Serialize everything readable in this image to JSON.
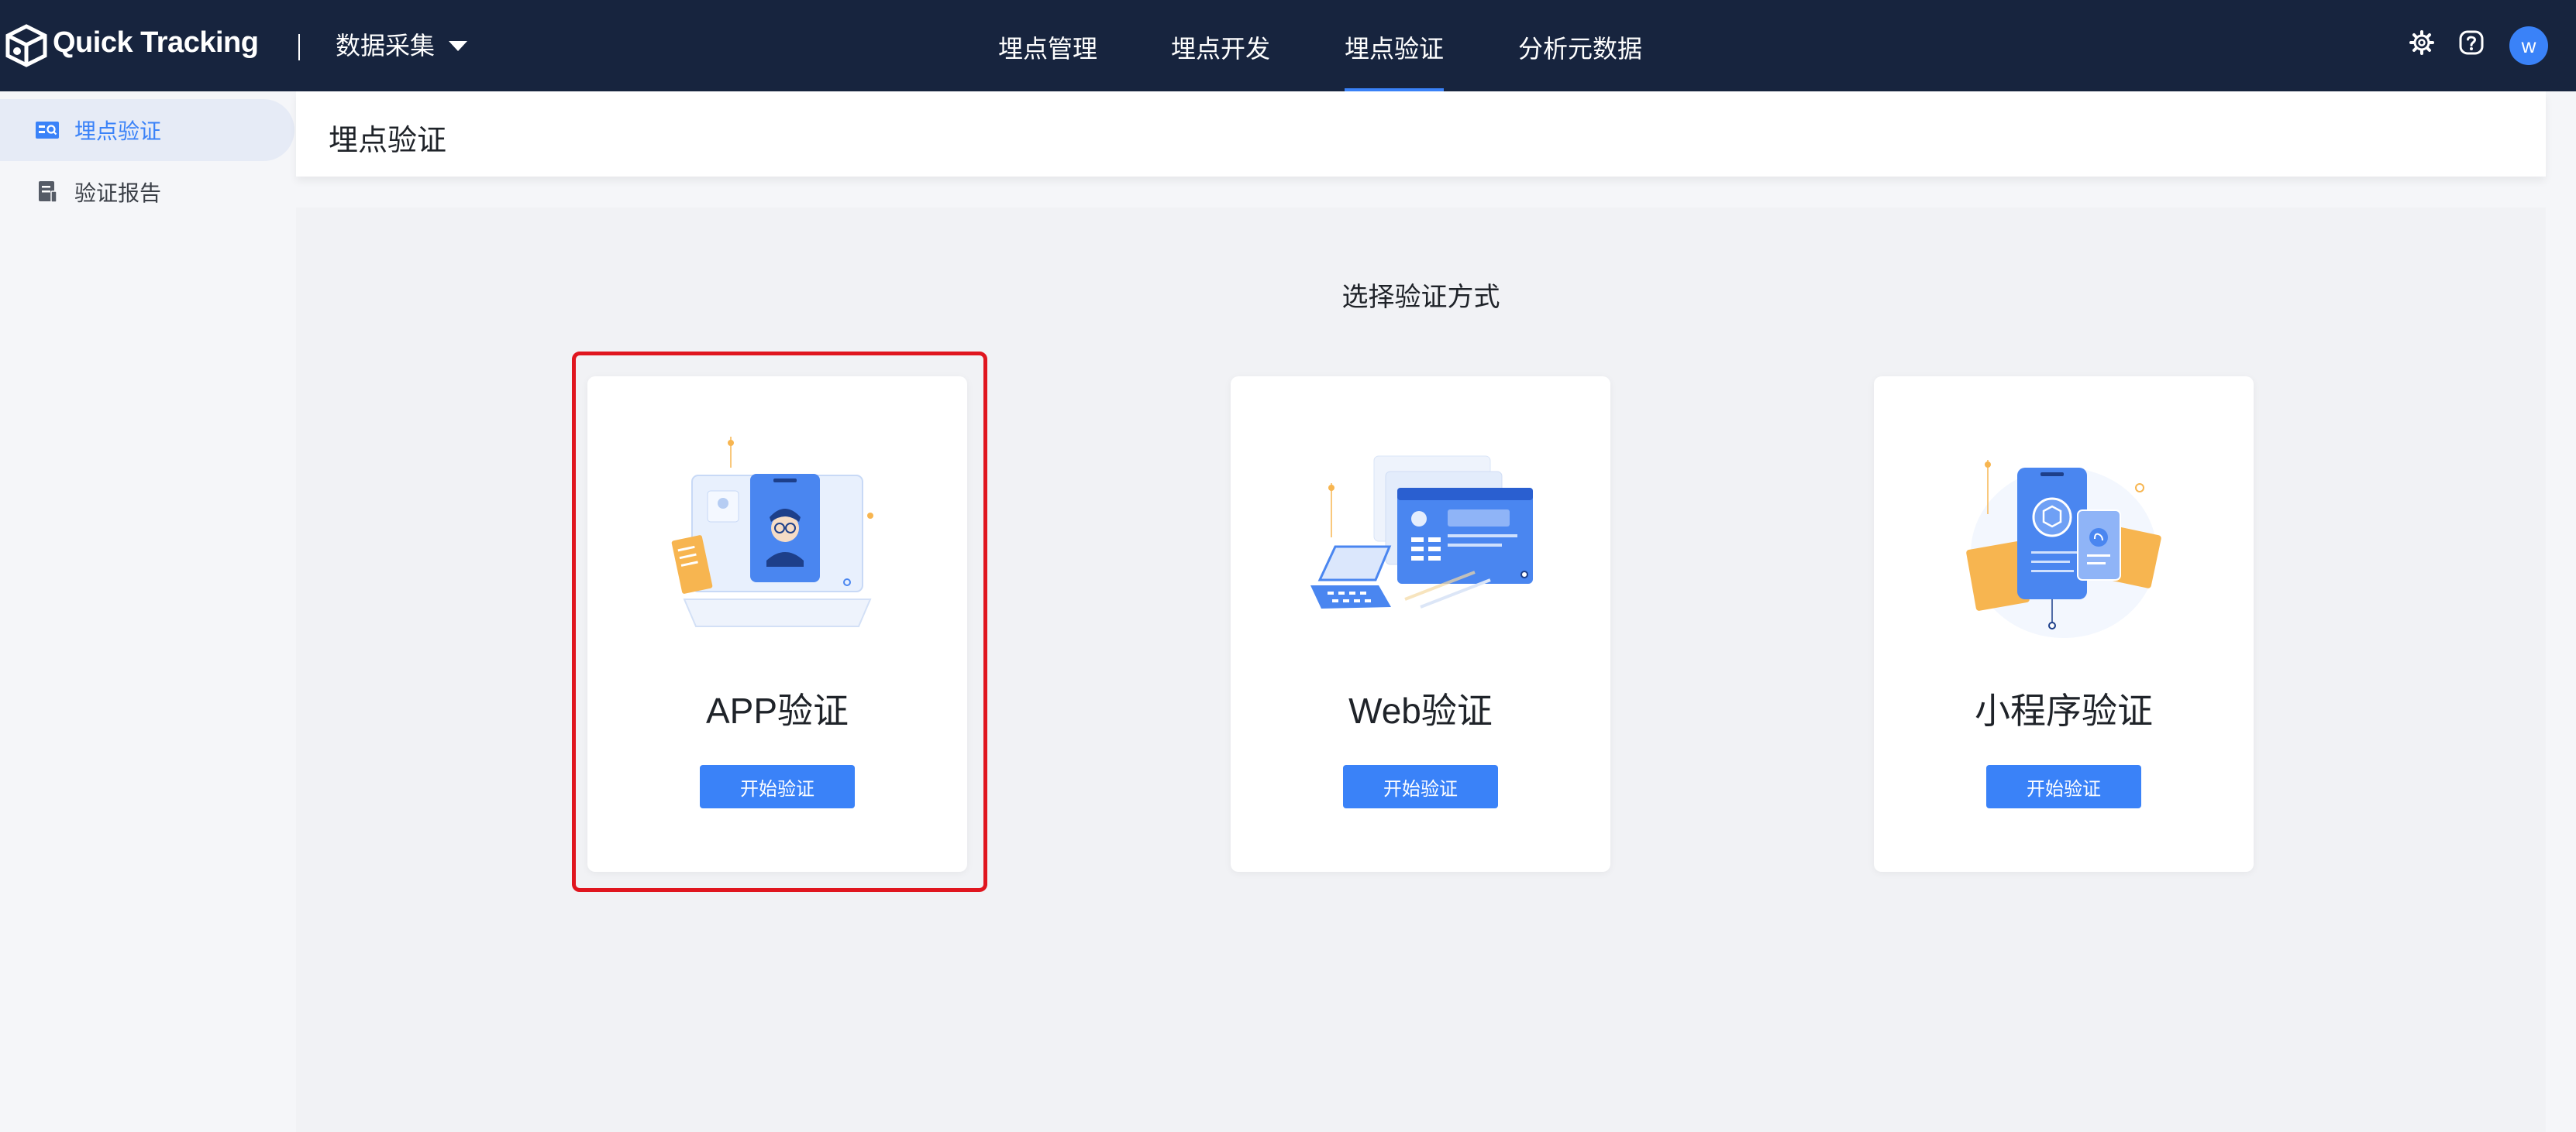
{
  "header": {
    "app_name": "Quick Tracking",
    "project": "数据采集",
    "nav_tabs": [
      {
        "label": "埋点管理",
        "active": false
      },
      {
        "label": "埋点开发",
        "active": false
      },
      {
        "label": "埋点验证",
        "active": true
      },
      {
        "label": "分析元数据",
        "active": false
      }
    ],
    "icons": [
      "gear-icon",
      "help-icon"
    ],
    "avatar_letter": "w"
  },
  "sidebar": {
    "items": [
      {
        "label": "埋点验证",
        "icon": "verify-icon",
        "active": true
      },
      {
        "label": "验证报告",
        "icon": "report-icon",
        "active": false
      }
    ]
  },
  "page": {
    "title": "埋点验证",
    "section_title": "选择验证方式"
  },
  "cards": [
    {
      "title": "APP验证",
      "button": "开始验证",
      "illustration": "app-illustration",
      "highlighted": true
    },
    {
      "title": "Web验证",
      "button": "开始验证",
      "illustration": "web-illustration",
      "highlighted": false
    },
    {
      "title": "小程序验证",
      "button": "开始验证",
      "illustration": "miniprogram-illustration",
      "highlighted": false
    }
  ],
  "colors": {
    "topbar": "#17243e",
    "accent": "#3a82f8",
    "highlight_border": "#e0161f",
    "background": "#f5f6f9"
  }
}
